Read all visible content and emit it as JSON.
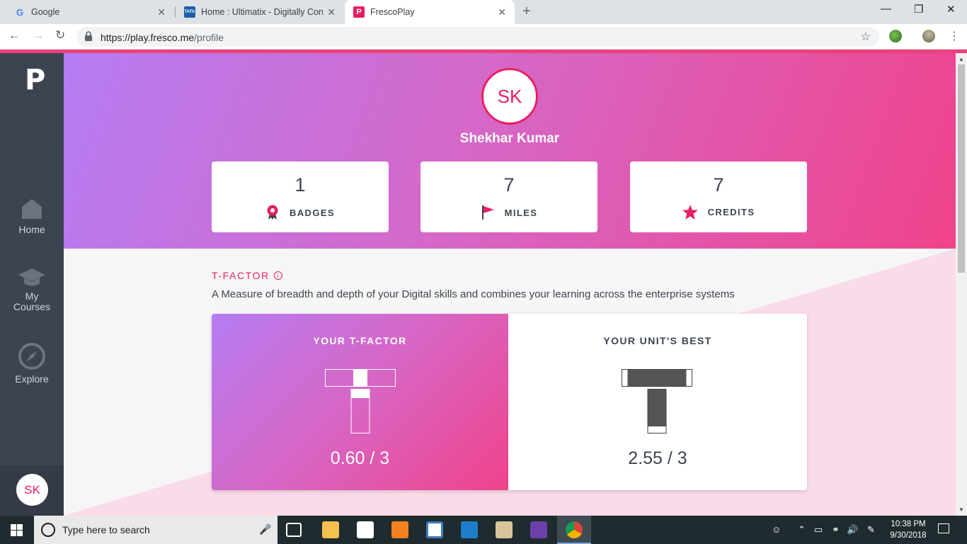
{
  "browser": {
    "tabs": [
      {
        "title": "Google",
        "favicon": "google-g-icon"
      },
      {
        "title": "Home : Ultimatix - Digitally Conn",
        "favicon": "tata-icon"
      },
      {
        "title": "FrescoPlay",
        "favicon": "frescoplay-p-icon"
      }
    ],
    "new_tab": "+",
    "close": "✕",
    "url_host": "https://play.fresco.me",
    "url_path": "/profile"
  },
  "sidebar": {
    "logo": "P",
    "items": [
      {
        "label": "Home",
        "icon": "home-icon"
      },
      {
        "label": "My\nCourses",
        "icon": "graduation-cap-icon"
      },
      {
        "label": "Explore",
        "icon": "compass-icon"
      }
    ],
    "avatar": "SK"
  },
  "profile": {
    "initials": "SK",
    "name": "Shekhar Kumar",
    "stats": [
      {
        "value": "1",
        "label": "BADGES",
        "icon": "badge-icon"
      },
      {
        "value": "7",
        "label": "MILES",
        "icon": "flag-icon"
      },
      {
        "value": "7",
        "label": "CREDITS",
        "icon": "star-icon"
      }
    ]
  },
  "tfactor": {
    "title": "T-FACTOR",
    "info": "i",
    "description": "A Measure of breadth and depth of your Digital skills and combines your learning across the enterprise systems",
    "yours": {
      "label": "YOUR T-FACTOR",
      "score": "0.60 / 3",
      "value": 0.6,
      "max": 3
    },
    "unit_best": {
      "label": "YOUR UNIT'S BEST",
      "score": "2.55 / 3",
      "value": 2.55,
      "max": 3
    }
  },
  "taskbar": {
    "search_placeholder": "Type here to search",
    "time": "10:38 PM",
    "date": "9/30/2018"
  },
  "colors": {
    "accent": "#e91e63",
    "sidebar": "#3d4451",
    "gradient_start": "#b57cf2",
    "gradient_end": "#f0438a"
  }
}
